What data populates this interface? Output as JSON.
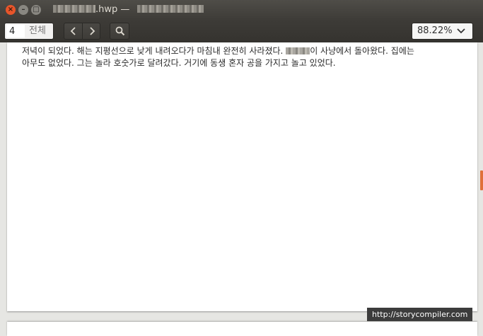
{
  "window": {
    "close_glyph": "×",
    "minimize_glyph": "–",
    "maximize_glyph": "□",
    "title_suffix": ".hwp —"
  },
  "toolbar": {
    "page_number": "4",
    "page_total": "전체",
    "prev_glyph": "‹",
    "next_glyph": "›",
    "zoom": "88.22%"
  },
  "document": {
    "line1_start": "저녁이 되었다. 해는 지평선으로 낮게 내려오다가 마침내 완전히 사라졌다.",
    "line1_end": "이 사냥에서 돌아왔다. 집에는",
    "line2": "아무도 없었다. 그는 놀라 호숫가로 달려갔다. 거기에 동생 혼자 공을 가지고 놀고 있었다."
  },
  "watermark": "http://storycompiler.com",
  "colors": {
    "titlebar": "#3d3b37",
    "close_button": "#e8552a",
    "scroll_accent": "#e0703a",
    "canvas": "#e6e6e3"
  }
}
